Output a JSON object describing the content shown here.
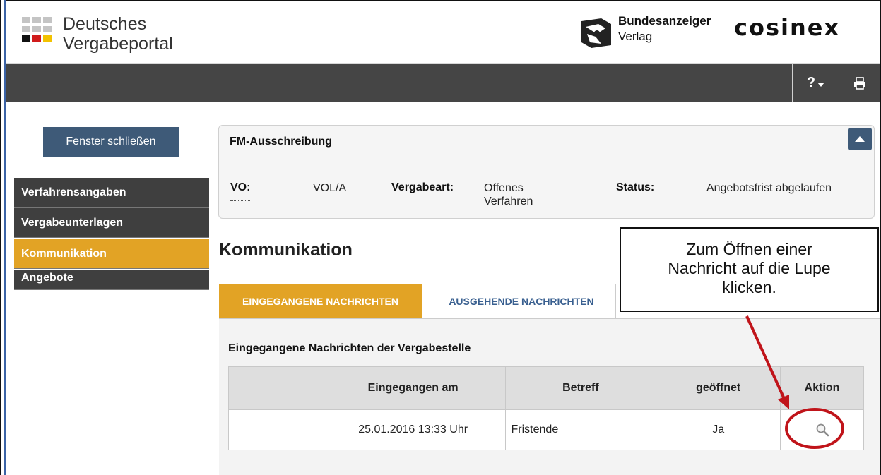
{
  "header": {
    "logo_line1": "Deutsches",
    "logo_line2": "Vergabeportal",
    "publisher_name": "Bundesanzeiger",
    "publisher_sub": "Verlag",
    "partner_logo": "cosinex"
  },
  "topbar": {
    "help_label": "?",
    "print_icon": "printer-icon"
  },
  "sidebar": {
    "close_button": "Fenster schließen",
    "items": [
      {
        "label": "Verfahrensangaben",
        "active": false
      },
      {
        "label": "Vergabeunterlagen",
        "active": false
      },
      {
        "label": "Kommunikation",
        "active": true
      },
      {
        "label": "Angebote",
        "active": false
      }
    ]
  },
  "info_panel": {
    "title": "FM-Ausschreibung",
    "vo_label": "VO:",
    "vo_value": "VOL/A",
    "vergabeart_label": "Vergabeart:",
    "vergabeart_value_line1": "Offenes",
    "vergabeart_value_line2": "Verfahren",
    "status_label": "Status:",
    "status_value": "Angebotsfrist abgelaufen"
  },
  "main": {
    "heading": "Kommunikation",
    "tabs": [
      {
        "label": "EINGEGANGENE NACHRICHTEN",
        "active": true
      },
      {
        "label": "AUSGEHENDE NACHRICHTEN",
        "active": false
      }
    ],
    "content_title": "Eingegangene Nachrichten der Vergabestelle",
    "table": {
      "columns": [
        "",
        "Eingegangen am",
        "Betreff",
        "geöffnet",
        "Aktion"
      ],
      "rows": [
        {
          "blank": "",
          "received": "25.01.2016 13:33 Uhr",
          "subject": "Fristende",
          "opened": "Ja",
          "action_icon": "magnifier-icon"
        }
      ]
    }
  },
  "annotation": {
    "callout_line1": "Zum Öffnen einer",
    "callout_line2": "Nachricht auf die Lupe",
    "callout_line3": "klicken."
  },
  "colors": {
    "accent": "#e2a325",
    "dark_bar": "#454545",
    "nav_dark": "#3f3f3f",
    "button_blue": "#3e5a78",
    "annotation_red": "#c0141a"
  }
}
